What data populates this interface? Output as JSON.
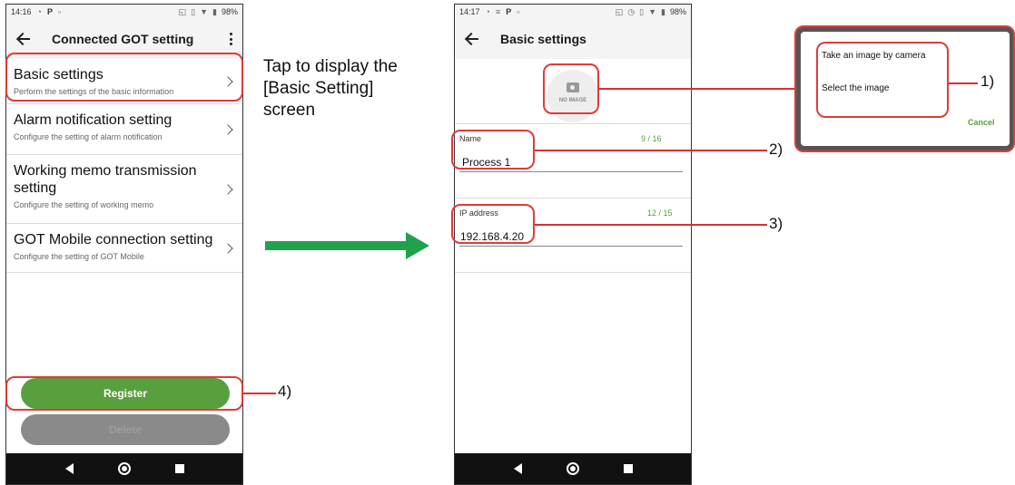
{
  "screen1": {
    "status": {
      "time": "14:16",
      "p": "P",
      "battery": "98%"
    },
    "title": "Connected GOT setting",
    "items": [
      {
        "title": "Basic settings",
        "desc": "Perform the settings of the basic information"
      },
      {
        "title": "Alarm notification setting",
        "desc": "Configure the setting of alarm notification"
      },
      {
        "title": "Working memo transmission setting",
        "desc": "Configure the setting of working memo"
      },
      {
        "title": "GOT Mobile connection setting",
        "desc": "Configure the setting of GOT Mobile"
      }
    ],
    "register_label": "Register",
    "delete_label": "Delete"
  },
  "screen2": {
    "status": {
      "time": "14:17",
      "p": "P",
      "battery": "98%"
    },
    "title": "Basic settings",
    "no_image": "NO IMAGE",
    "name_label": "Name",
    "name_count": "9 / 16",
    "name_value": "Process 1",
    "ip_label": "IP address",
    "ip_count": "12 / 15",
    "ip_value": "192.168.4.20"
  },
  "dialog": {
    "take_image": "Take an image by camera",
    "select_image": "Select the image",
    "cancel": "Cancel"
  },
  "annotations": {
    "tap_note_line1": "Tap to display the",
    "tap_note_line2": "[Basic Setting]",
    "tap_note_line3": "screen",
    "n1": "1)",
    "n2": "2)",
    "n3": "3)",
    "n4": "4)"
  },
  "colors": {
    "green": "#5a9f3e",
    "arrow": "#1fa24a",
    "callout": "#e23a3a"
  }
}
